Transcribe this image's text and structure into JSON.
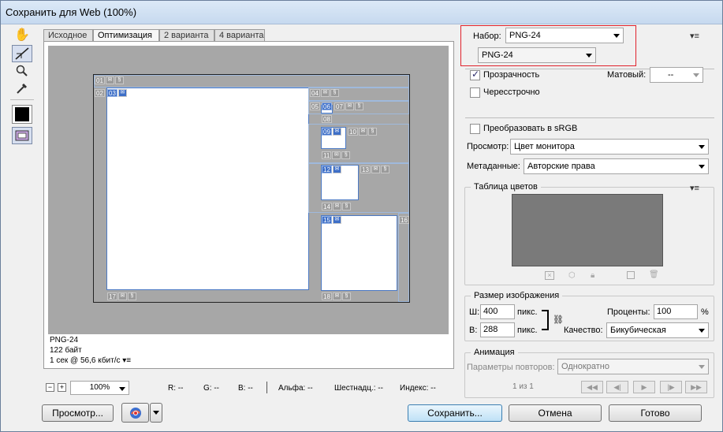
{
  "window": {
    "title": "Сохранить для Web (100%)"
  },
  "tabs": [
    "Исходное",
    "Оптимизация",
    "2 варианта",
    "4 варианта"
  ],
  "slices": [
    "01",
    "02",
    "03",
    "04",
    "05",
    "06",
    "07",
    "08",
    "09",
    "10",
    "11",
    "12",
    "13",
    "14",
    "15",
    "16",
    "17",
    "18"
  ],
  "info": {
    "format": "PNG-24",
    "size": "122 байт",
    "speed": "1 сек @ 56,6 кбит/с"
  },
  "statusbar": {
    "zoom": "100%",
    "r": "R: --",
    "g": "G: --",
    "b": "B: --",
    "alpha": "Альфа: --",
    "hex": "Шестнадц.: --",
    "index": "Индекс: --"
  },
  "buttons": {
    "preview": "Просмотр...",
    "save": "Сохранить...",
    "cancel": "Отмена",
    "done": "Готово"
  },
  "settings": {
    "preset_label": "Набор:",
    "preset_value": "PNG-24",
    "format_value": "PNG-24",
    "transparency_label": "Прозрачность",
    "matte_label": "Матовый:",
    "matte_value": "--",
    "interlaced_label": "Чересстрочно",
    "convert_srgb_label": "Преобразовать в sRGB",
    "preview_label": "Просмотр:",
    "preview_value": "Цвет монитора",
    "metadata_label": "Метаданные:",
    "metadata_value": "Авторские права"
  },
  "color_table": {
    "title": "Таблица цветов"
  },
  "image_size": {
    "title": "Размер изображения",
    "w_label": "Ш:",
    "w_value": "400",
    "w_unit": "пикс.",
    "h_label": "В:",
    "h_value": "288",
    "h_unit": "пикс.",
    "percent_label": "Проценты:",
    "percent_value": "100",
    "percent_sign": "%",
    "quality_label": "Качество:",
    "quality_value": "Бикубическая"
  },
  "animation": {
    "title": "Анимация",
    "loop_label": "Параметры повторов:",
    "loop_value": "Однократно",
    "frame_counter": "1 из 1"
  },
  "colors": {
    "highlight_border": "#e0212b",
    "slice_blue": "#3e6fc7",
    "canvas_gray": "#a7a7a7"
  }
}
